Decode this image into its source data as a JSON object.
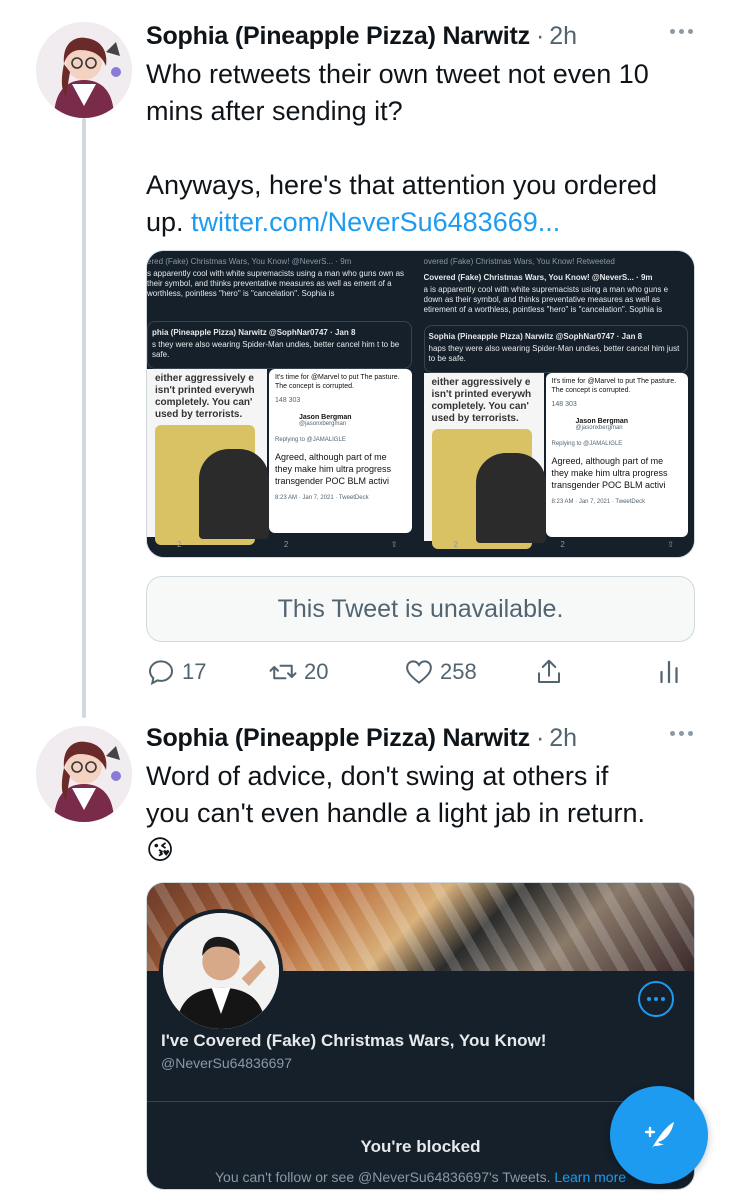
{
  "tweet1": {
    "author": "Sophia (Pineapple Pizza) Narwitz",
    "separator": "·",
    "time": "2h",
    "text_line1": "Who retweets their own tweet not even 10",
    "text_line2": "mins after sending it?",
    "text_line3": "Anyways, here's that attention you ordered",
    "text_prefix": "up. ",
    "link": "twitter.com/NeverSu6483669...",
    "media": {
      "left": {
        "title": "ered (Fake) Christmas Wars, You Know! @NeverS... · 9m",
        "name": "",
        "text": "s apparently cool with white supremacists using a man who guns own as their symbol, and thinks preventative measures as well as ement of a worthless, pointless \"hero\" is \"cancelation\". Sophia is",
        "quote_name": "phia (Pineapple Pizza) Narwitz @SophNar0747 · Jan 8",
        "quote_text": "s they were also wearing Spider-Man undies, better cancel him t to be safe.",
        "meme_text": "either aggressively e isn't printed everywh completely. You can' used by terrorists.",
        "panel_text": "It's time for @Marvel to put The pasture. The concept is corrupted.",
        "panel_stats": "148   303",
        "panel_user": "Jason Bergman",
        "panel_handle": "@jasonxbergman",
        "panel_reply": "Replying to @JAMALIGLE",
        "panel_body": "Agreed, although part of me they make him ultra progress transgender POC BLM activi",
        "panel_date": "8:23 AM · Jan 7, 2021 · TweetDeck",
        "retweets": "2",
        "likes": "2"
      },
      "right": {
        "title": "overed (Fake) Christmas Wars, You Know! Retweeted",
        "name": "Covered (Fake) Christmas Wars, You Know! @NeverS... · 9m",
        "text": "a is apparently cool with white supremacists using a man who guns e down as their symbol, and thinks preventative measures as well as etirement of a worthless, pointless \"hero\" is \"cancelation\". Sophia is",
        "quote_name": "Sophia (Pineapple Pizza) Narwitz @SophNar0747 · Jan 8",
        "quote_text": "haps they were also wearing Spider-Man undies, better cancel him just to be safe.",
        "meme_text": "either aggressively e isn't printed everywh completely. You can' used by terrorists.",
        "panel_text": "It's time for @Marvel to put The pasture. The concept is corrupted.",
        "panel_stats": "148   303",
        "panel_user": "Jason Bergman",
        "panel_handle": "@jasonxbergman",
        "panel_reply": "Replying to @JAMALIGLE",
        "panel_body": "Agreed, although part of me they make him ultra progress transgender POC BLM activi",
        "panel_date": "8:23 AM · Jan 7, 2021 · TweetDeck",
        "retweets": "2",
        "likes": "2"
      }
    },
    "unavailable": "This Tweet is unavailable.",
    "replies": "17",
    "retweets": "20",
    "likes": "258"
  },
  "tweet2": {
    "author": "Sophia (Pineapple Pizza) Narwitz",
    "separator": "·",
    "time": "2h",
    "text_line1": "Word of advice, don't swing at others if",
    "text_line2": "you can't even handle a light jab in return.",
    "emoji": "😘",
    "card": {
      "name": "I've Covered (Fake) Christmas Wars, You Know!",
      "handle": "@NeverSu64836697",
      "blocked": "You're blocked",
      "sub_text": "You can't follow or see @NeverSu64836697's Tweets. ",
      "learn_more": "Learn more"
    }
  },
  "colors": {
    "accent": "#1d9bf0",
    "text": "#0f1419",
    "muted": "#536471",
    "dark_card": "#15202b"
  },
  "icons": [
    "reply-icon",
    "retweet-icon",
    "like-icon",
    "share-icon",
    "analytics-icon",
    "more-icon",
    "compose-tweet-icon"
  ]
}
